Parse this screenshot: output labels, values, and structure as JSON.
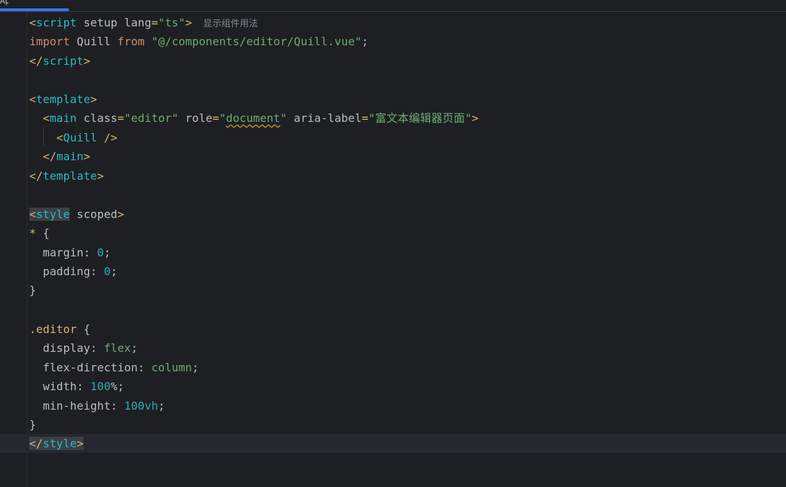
{
  "tab": {
    "label_fragment": "App"
  },
  "inlay_hint": "显示组件用法",
  "code": {
    "l1": {
      "lt": "<",
      "tag": "script",
      "a1": "setup",
      "a2": "lang",
      "eq": "=",
      "v": "\"ts\"",
      "gt": ">"
    },
    "l2": {
      "kw1": "import",
      "name": "Quill",
      "kw2": "from",
      "path": "\"@/components/editor/Quill.vue\"",
      "semi": ";"
    },
    "l3": {
      "lt": "</",
      "tag": "script",
      "gt": ">"
    },
    "l5": {
      "lt": "<",
      "tag": "template",
      "gt": ">"
    },
    "l6": {
      "lt": "<",
      "tag": "main",
      "a1": "class",
      "v1": "\"editor\"",
      "a2": "role",
      "v2q1": "\"",
      "v2": "document",
      "v2q2": "\"",
      "a3": "aria-label",
      "v3": "\"富文本编辑器页面\"",
      "eq": "=",
      "gt": ">"
    },
    "l7": {
      "lt": "<",
      "tag": "Quill",
      "end": " />"
    },
    "l8": {
      "lt": "</",
      "tag": "main",
      "gt": ">"
    },
    "l9": {
      "lt": "</",
      "tag": "template",
      "gt": ">"
    },
    "l11": {
      "lt": "<",
      "tag": "style",
      "a1": "scoped",
      "gt": ">"
    },
    "l12": {
      "sel": "*",
      "brace": "{"
    },
    "l13": {
      "prop": "margin",
      "colon": ":",
      "val": "0",
      "semi": ";"
    },
    "l14": {
      "prop": "padding",
      "colon": ":",
      "val": "0",
      "semi": ";"
    },
    "l15": {
      "brace": "}"
    },
    "l17": {
      "sel": ".editor",
      "brace": "{"
    },
    "l18": {
      "prop": "display",
      "colon": ":",
      "val": "flex",
      "semi": ";"
    },
    "l19": {
      "prop": "flex-direction",
      "colon": ":",
      "val": "column",
      "semi": ";"
    },
    "l20": {
      "prop": "width",
      "colon": ":",
      "num": "100",
      "unit": "%",
      "semi": ";"
    },
    "l21": {
      "prop": "min-height",
      "colon": ":",
      "num": "100vh",
      "semi": ";"
    },
    "l22": {
      "brace": "}"
    },
    "l23": {
      "lt": "</",
      "tag": "style",
      "gt": ">"
    }
  },
  "colors": {
    "background": "#1e1f22",
    "tag": "#d5b778",
    "tag_name": "#2bbac5",
    "string": "#6aab73",
    "keyword": "#cf8e6d",
    "number": "#2aacb8",
    "text": "#bcbec4",
    "accent": "#3574f0"
  }
}
